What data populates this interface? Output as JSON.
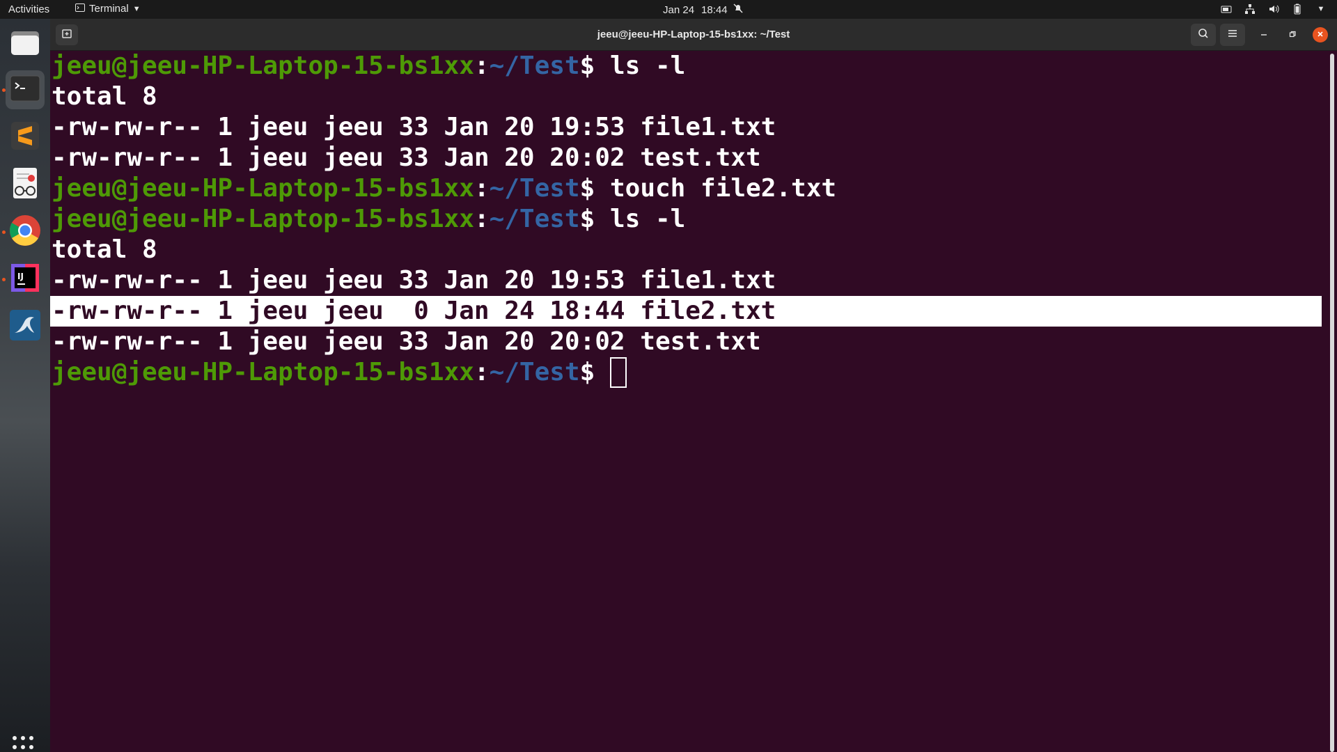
{
  "topbar": {
    "activities": "Activities",
    "app_name": "Terminal",
    "date": "Jan 24",
    "time": "18:44"
  },
  "dock": {
    "items": [
      "files-icon",
      "terminal-icon",
      "sublime-text-icon",
      "document-viewer-icon",
      "chrome-icon",
      "intellij-icon",
      "mysql-workbench-icon"
    ]
  },
  "window": {
    "title": "jeeu@jeeu-HP-Laptop-15-bs1xx: ~/Test"
  },
  "terminal": {
    "prompt_user": "jeeu@jeeu-HP-Laptop-15-bs1xx",
    "prompt_sep": ":",
    "prompt_path": "~/Test",
    "prompt_dollar": "$ ",
    "cmd1": "ls -l",
    "total1": "total 8",
    "ls1_row1": "-rw-rw-r-- 1 jeeu jeeu 33 Jan 20 19:53 file1.txt",
    "ls1_row2": "-rw-rw-r-- 1 jeeu jeeu 33 Jan 20 20:02 test.txt",
    "cmd2": "touch file2.txt",
    "cmd3": "ls -l",
    "total2": "total 8",
    "ls2_row1": "-rw-rw-r-- 1 jeeu jeeu 33 Jan 20 19:53 file1.txt",
    "ls2_row2": "-rw-rw-r-- 1 jeeu jeeu  0 Jan 24 18:44 file2.txt",
    "ls2_row3": "-rw-rw-r-- 1 jeeu jeeu 33 Jan 20 20:02 test.txt"
  },
  "colors": {
    "terminal_bg": "#300a24",
    "prompt_user": "#4e9a06",
    "prompt_path": "#3465a4",
    "accent": "#e95420"
  }
}
